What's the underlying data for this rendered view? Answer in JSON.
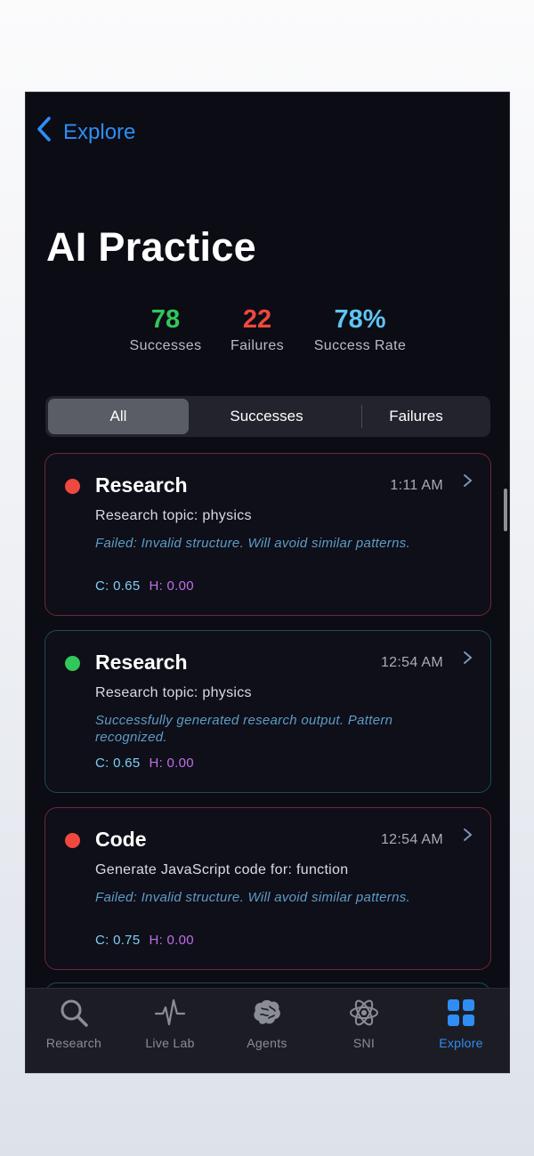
{
  "nav": {
    "back_label": "Explore"
  },
  "title": "AI Practice",
  "stats": {
    "successes": {
      "value": "78",
      "label": "Successes",
      "color": "#31c75a"
    },
    "failures": {
      "value": "22",
      "label": "Failures",
      "color": "#f0473f"
    },
    "rate": {
      "value": "78%",
      "label": "Success Rate",
      "color": "#5ec5f2"
    }
  },
  "filter": {
    "options": [
      "All",
      "Successes",
      "Failures"
    ],
    "selected": "All"
  },
  "cards": [
    {
      "status": "failure",
      "dot_color": "#f0473f",
      "title": "Research",
      "time": "1:11 AM",
      "description": "Research topic: physics",
      "note": "Failed: Invalid structure. Will avoid similar patterns.",
      "c": "C: 0.65",
      "h": "H: 0.00"
    },
    {
      "status": "success",
      "dot_color": "#31c75a",
      "title": "Research",
      "time": "12:54 AM",
      "description": "Research topic: physics",
      "note": "Successfully generated research output. Pattern recognized.",
      "c": "C: 0.65",
      "h": "H: 0.00"
    },
    {
      "status": "failure",
      "dot_color": "#f0473f",
      "title": "Code",
      "time": "12:54 AM",
      "description": "Generate JavaScript code for: function",
      "note": "Failed: Invalid structure. Will avoid similar patterns.",
      "c": "C: 0.75",
      "h": "H: 0.00"
    }
  ],
  "tabs": [
    {
      "label": "Research",
      "icon": "search-icon"
    },
    {
      "label": "Live Lab",
      "icon": "pulse-icon"
    },
    {
      "label": "Agents",
      "icon": "brain-icon"
    },
    {
      "label": "SNI",
      "icon": "atom-icon"
    },
    {
      "label": "Explore",
      "icon": "grid-icon",
      "active": true
    }
  ],
  "colors": {
    "accent": "#2f8df5",
    "background": "#0b0c14"
  }
}
